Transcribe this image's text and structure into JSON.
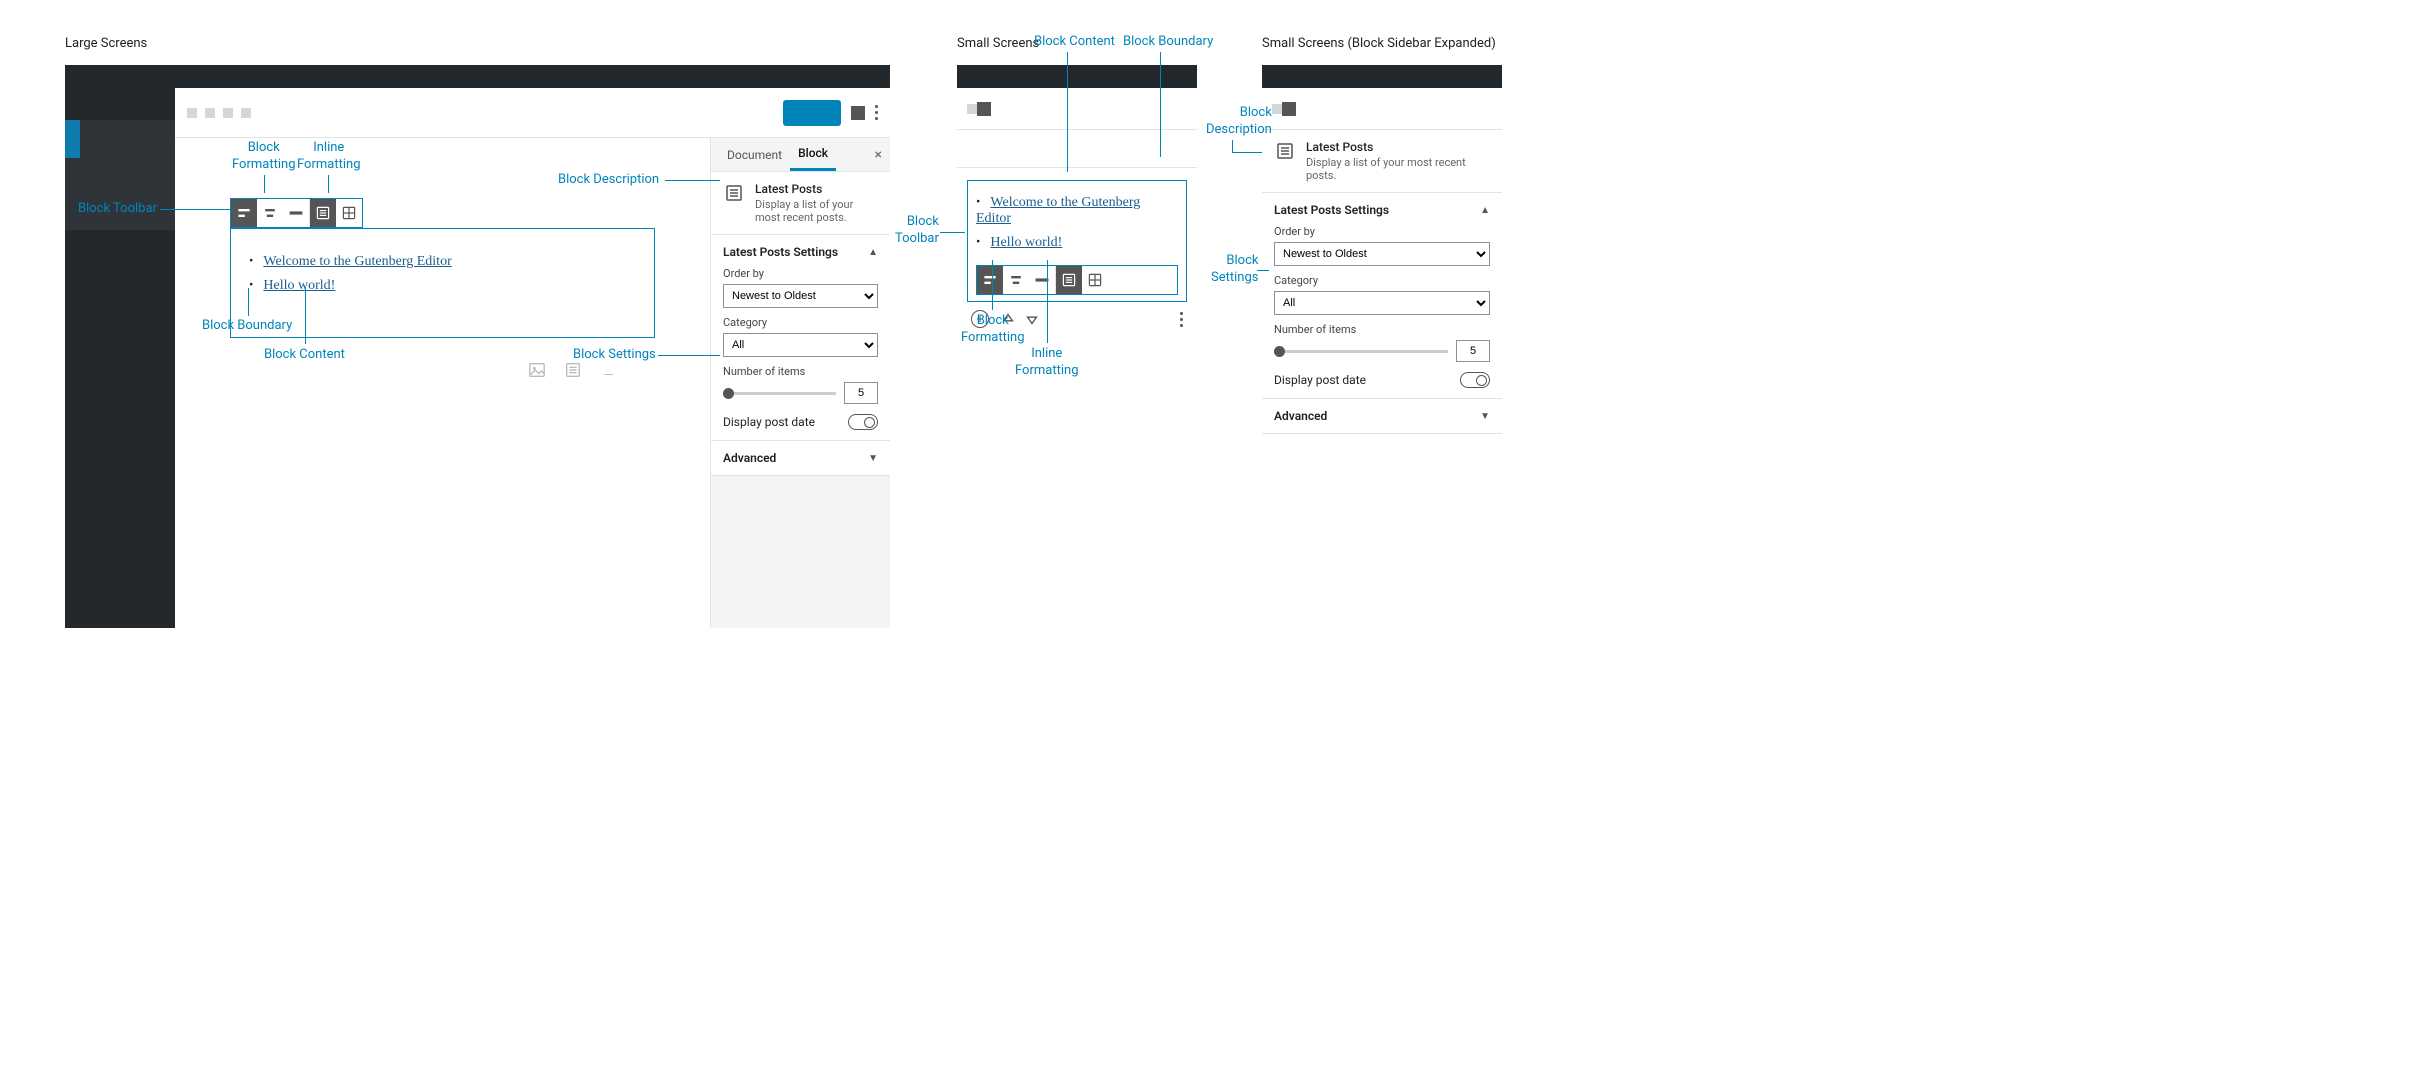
{
  "headings": {
    "large": "Large Screens",
    "small": "Small Screens",
    "small_expanded": "Small Screens (Block Sidebar Expanded)"
  },
  "annotations": {
    "block_toolbar": "Block Toolbar",
    "block_formatting": "Block\nFormatting",
    "inline_formatting": "Inline\nFormatting",
    "block_boundary": "Block Boundary",
    "block_content": "Block Content",
    "block_description": "Block Description",
    "block_settings": "Block Settings"
  },
  "editor": {
    "posts": [
      "Welcome to the Gutenberg Editor",
      "Hello world!"
    ]
  },
  "inspector": {
    "tabs": {
      "document": "Document",
      "block": "Block"
    },
    "block_name": "Latest Posts",
    "block_desc": "Display a list of your most recent posts.",
    "settings_title": "Latest Posts Settings",
    "order_by_label": "Order by",
    "order_by_value": "Newest to Oldest",
    "category_label": "Category",
    "category_value": "All",
    "number_label": "Number of items",
    "number_value": "5",
    "display_date_label": "Display post date",
    "advanced_title": "Advanced"
  }
}
